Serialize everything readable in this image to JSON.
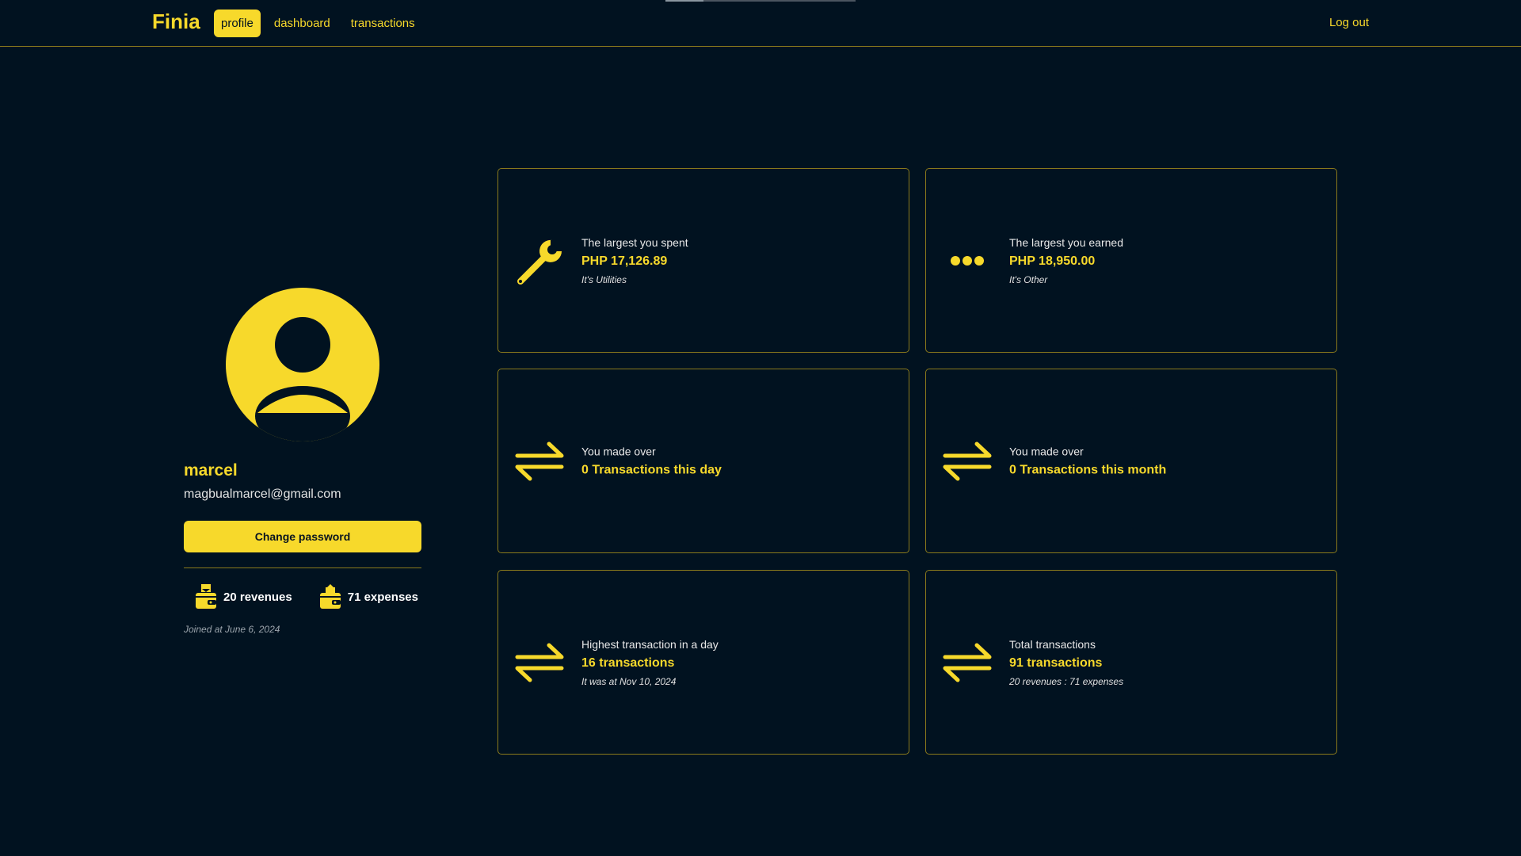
{
  "app": {
    "brand": "Finia",
    "accent_color": "#f7d92b",
    "background_color": "#011220"
  },
  "nav": {
    "items": [
      {
        "label": "profile",
        "active": true
      },
      {
        "label": "dashboard",
        "active": false
      },
      {
        "label": "transactions",
        "active": false
      }
    ],
    "logout_label": "Log out"
  },
  "profile": {
    "avatar_icon": "user-circle-icon",
    "username": "marcel",
    "email": "magbualmarcel@gmail.com",
    "change_password_label": "Change password",
    "revenues_text": "20 revenues",
    "revenues_icon": "wallet-in-icon",
    "expenses_text": "71 expenses",
    "expenses_icon": "wallet-out-icon",
    "joined": "Joined at June 6, 2024"
  },
  "cards": {
    "largest_spent": {
      "icon": "wrench-icon",
      "label": "The largest you spent",
      "value": "PHP 17,126.89",
      "note": "It's Utilities"
    },
    "largest_earned": {
      "icon": "ellipsis-icon",
      "label": "The largest you earned",
      "value": "PHP 18,950.00",
      "note": "It's Other"
    },
    "today": {
      "icon": "transfer-arrows-icon",
      "label": "You made over",
      "value": "0 Transactions this day"
    },
    "month": {
      "icon": "transfer-arrows-icon",
      "label": "You made over",
      "value": "0 Transactions this month"
    },
    "highest_day": {
      "icon": "transfer-arrows-icon",
      "label": "Highest transaction in a day",
      "value": "16 transactions",
      "note": "It was at Nov 10, 2024"
    },
    "total": {
      "icon": "transfer-arrows-icon",
      "label": "Total transactions",
      "value": "91 transactions",
      "note": "20 revenues : 71 expenses"
    }
  }
}
